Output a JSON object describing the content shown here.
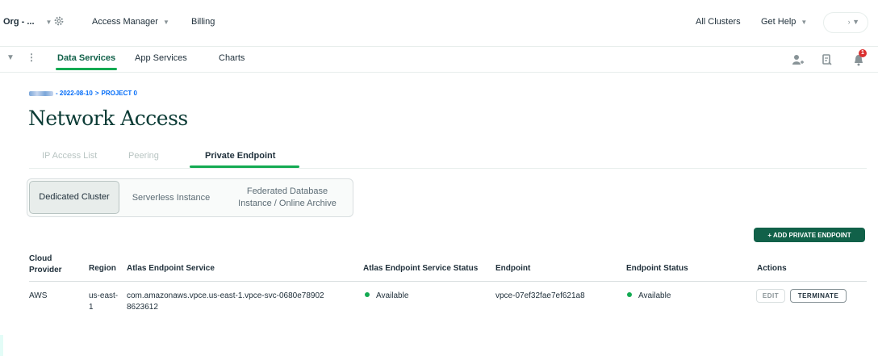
{
  "topbar": {
    "org_label": "Org - ...",
    "access_manager": "Access Manager",
    "billing": "Billing",
    "all_clusters": "All Clusters",
    "get_help": "Get Help"
  },
  "nav": {
    "tabs": [
      "Data Services",
      "App Services",
      "Charts"
    ],
    "active_tab": "Data Services",
    "notification_count": "1"
  },
  "breadcrumb": {
    "project_date": "- 2022-08-10",
    "separator": ">",
    "project": "PROJECT 0"
  },
  "page": {
    "title": "Network Access"
  },
  "tabs": {
    "items": [
      "IP Access List",
      "Peering",
      "Private Endpoint"
    ],
    "active": "Private Endpoint"
  },
  "segmented": {
    "options": [
      "Dedicated Cluster",
      "Serverless Instance",
      "Federated Database Instance / Online Archive"
    ],
    "active": "Dedicated Cluster"
  },
  "add_button": "+ ADD PRIVATE ENDPOINT",
  "table": {
    "headers": [
      "Cloud Provider",
      "Region",
      "Atlas Endpoint Service",
      "Atlas Endpoint Service Status",
      "Endpoint",
      "Endpoint Status",
      "Actions"
    ],
    "rows": [
      {
        "provider": "AWS",
        "region": "us-east-1",
        "service": "com.amazonaws.vpce.us-east-1.vpce-svc-0680e789028623612",
        "service_status": "Available",
        "endpoint": "vpce-07ef32fae7ef621a8",
        "endpoint_status": "Available",
        "actions": [
          "EDIT",
          "TERMINATE"
        ]
      }
    ]
  },
  "colors": {
    "brand_green": "#13aa52",
    "dark_green": "#116149",
    "title_color": "#0b3b35",
    "link_blue": "#016bf8",
    "alert_red": "#db3030"
  }
}
